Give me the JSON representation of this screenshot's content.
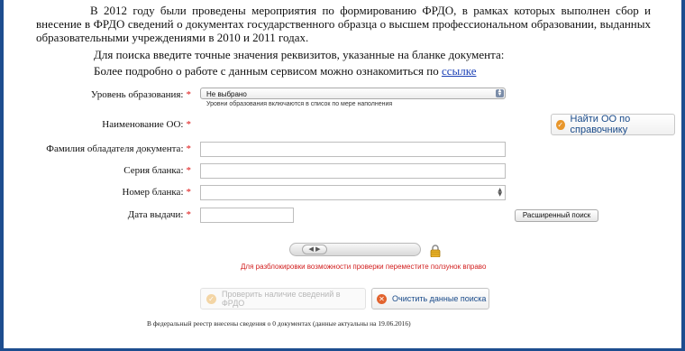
{
  "intro": {
    "text": "В 2012 году были проведены мероприятия по формированию ФРДО, в рамках которых выполнен сбор и внесение в ФРДО сведений о документах государственного образца о высшем профессиональном образовании, выданных образовательными учреждениями в 2010 и 2011 годах."
  },
  "hints": {
    "line1": "Для поиска введите точные значения реквизитов, указанные на бланке документа:",
    "line2_prefix": "Более подробно о работе с данным сервисом можно ознакомиться по",
    "line2_link": "ссылке"
  },
  "form": {
    "required_mark": "*",
    "education_level": {
      "label": "Уровень образования:",
      "value": "Не выбрано",
      "note": "Уровни образования включаются в список по мере наполнения"
    },
    "org_name": {
      "label": "Наименование ОО:",
      "button": "Найти ОО по справочнику"
    },
    "holder_surname": {
      "label": "Фамилия обладателя документа:",
      "value": ""
    },
    "blank_series": {
      "label": "Серия бланка:",
      "value": ""
    },
    "blank_number": {
      "label": "Номер бланка:",
      "value": ""
    },
    "issue_date": {
      "label": "Дата выдачи:",
      "value": ""
    },
    "advanced_search": "Расширенный поиск"
  },
  "unlock": {
    "note": "Для разблокировки возможности проверки переместите ползунок вправо",
    "slider_position": 0
  },
  "actions": {
    "check": "Проверить наличие сведений в ФРДО",
    "clear": "Очистить данные поиска"
  },
  "footer": {
    "text": "В федеральный реестр внесены сведения о 0 документах (данные актуальны на 19.06.2016)"
  },
  "colors": {
    "frame": "#1d4d8f",
    "required": "#dd1111",
    "link": "#1a3fb5",
    "warning": "#d21f1f",
    "accent_orange": "#e8962b"
  },
  "icons": {
    "ref_button_icon": "checkmark-badge-icon",
    "check_button_icon": "checkmark-badge-icon",
    "clear_button_icon": "clear-x-icon",
    "lock_icon": "lock-icon",
    "slider_thumb_icon": "arrow-left-right-icon"
  }
}
